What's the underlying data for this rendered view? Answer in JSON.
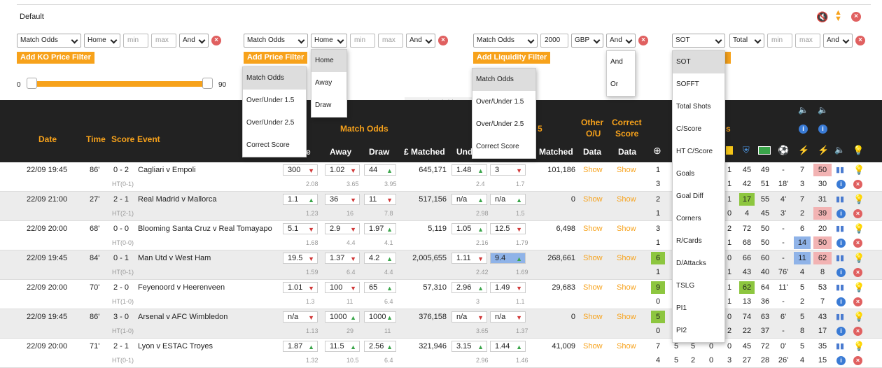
{
  "title": "Default",
  "filters": [
    {
      "market": "Match Odds",
      "selection": "Home",
      "min": "min",
      "max": "max",
      "op": "And"
    },
    {
      "market": "Match Odds",
      "selection": "Home",
      "min": "min",
      "max": "max",
      "op": "And"
    },
    {
      "market": "Match Odds",
      "amount": "2000",
      "currency": "GBP",
      "op": "And"
    },
    {
      "stat": "SOT",
      "scope": "Total",
      "min": "min",
      "max": "max",
      "op": "And"
    }
  ],
  "buttons": {
    "ko": "Add KO Price Filter",
    "price": "Add Price Filter",
    "liquidity": "Add Liquidity Filter"
  },
  "slider": {
    "min": "0",
    "max": "90"
  },
  "show_hide": "Show/Hide",
  "dropdowns": {
    "market": [
      "Match Odds",
      "Over/Under 1.5",
      "Over/Under 2.5",
      "Correct Score"
    ],
    "selection": [
      "Home",
      "Away",
      "Draw"
    ],
    "liquidity_market": [
      "Match Odds",
      "Over/Under 1.5",
      "Over/Under 2.5",
      "Correct Score"
    ],
    "op": [
      "And",
      "Or"
    ],
    "stat": [
      "SOT",
      "SOFFT",
      "Total Shots",
      "C/Score",
      "HT C/Score",
      "Goals",
      "Goal Diff",
      "Corners",
      "R/Cards",
      "D/Attacks",
      "TSLG",
      "PI1",
      "PI2"
    ]
  },
  "header": {
    "date": "Date",
    "time": "Time",
    "score": "Score",
    "event": "Event",
    "match_odds": "Match Odds",
    "home": "e",
    "away": "Away",
    "draw": "Draw",
    "matched": "£ Matched",
    "under": "Und",
    "over_partial": "5",
    "matched2": "Matched",
    "other1": "Other",
    "other2": "O/U",
    "correct1": "Correct",
    "correct2": "Score",
    "data": "Data",
    "stats_partial": "s"
  },
  "show_label": "Show",
  "rows": [
    {
      "date": "22/09 19:45",
      "time": "86'",
      "score": "0 - 2",
      "event": "Cagliari v Empoli",
      "ht": "HT(0-1)",
      "home": "300",
      "hd": "dn",
      "away": "1.02",
      "ad": "dn",
      "draw": "44",
      "dd": "up",
      "ho": "2.08",
      "ao": "3.65",
      "do": "3.95",
      "matched": "645,171",
      "u": "1.48",
      "ud": "up",
      "o": "3",
      "od": "dn",
      "uo": "2.4",
      "oo": "1.7",
      "m2": "101,186",
      "s1": "1",
      "s2": "3",
      "a1": "1",
      "a2": "1",
      "b1": "45",
      "b2": "42",
      "c1": "49",
      "c2": "51",
      "d1": "-",
      "d2": "18'",
      "e1": "7",
      "e2": "3",
      "f1": "50",
      "f2": "30",
      "f1c": "#f2b3b3",
      "ac": "",
      "gc": ""
    },
    {
      "date": "22/09 21:00",
      "time": "27'",
      "score": "2 - 1",
      "event": "Real Madrid v Mallorca",
      "ht": "HT(2-1)",
      "home": "1.1",
      "hd": "up",
      "away": "36",
      "ad": "dn",
      "draw": "11",
      "dd": "dn",
      "ho": "1.23",
      "ao": "16",
      "do": "7.8",
      "matched": "517,156",
      "u": "n/a",
      "ud": "up",
      "o": "n/a",
      "od": "up",
      "uo": "2.98",
      "oo": "1.5",
      "m2": "0",
      "s1": "2",
      "s2": "1",
      "a1": "1",
      "a2": "0",
      "b1": "17",
      "b2": "4",
      "c1": "55",
      "c2": "45",
      "d1": "4'",
      "d2": "3'",
      "e1": "7",
      "e2": "2",
      "f1": "31",
      "f2": "39",
      "f1c": "",
      "ac": "#8dc63f",
      "gc": "#f2b3b3"
    },
    {
      "date": "22/09 20:00",
      "time": "68'",
      "score": "0 - 0",
      "event": "Blooming Santa Cruz v Real Tomayapo",
      "ht": "HT(0-0)",
      "home": "5.1",
      "hd": "dn",
      "away": "2.9",
      "ad": "dn",
      "draw": "1.97",
      "dd": "up",
      "ho": "1.68",
      "ao": "4.4",
      "do": "4.1",
      "matched": "5,119",
      "u": "1.05",
      "ud": "up",
      "o": "12.5",
      "od": "dn",
      "uo": "2.16",
      "oo": "1.79",
      "m2": "6,498",
      "s1": "3",
      "s2": "1",
      "a1": "2",
      "a2": "1",
      "b1": "72",
      "b2": "68",
      "c1": "50",
      "c2": "50",
      "d1": "-",
      "d2": "-",
      "e1": "6",
      "e2": "14",
      "f1": "20",
      "f2": "50",
      "f1c": "",
      "ac": "",
      "gc": "#f2b3b3"
    },
    {
      "date": "22/09 19:45",
      "time": "84'",
      "score": "0 - 1",
      "event": "Man Utd v West Ham",
      "ht": "HT(0-1)",
      "home": "19.5",
      "hd": "dn",
      "away": "1.37",
      "ad": "dn",
      "draw": "4.2",
      "dd": "up",
      "ho": "1.59",
      "ao": "6.4",
      "do": "4.4",
      "matched": "2,005,655",
      "u": "1.11",
      "ud": "dn",
      "o": "9.4",
      "od": "up",
      "uo": "2.42",
      "oo": "1.69",
      "m2": "268,661",
      "s1": "6",
      "s2": "1",
      "a1": "0",
      "a2": "1",
      "b1": "66",
      "b2": "43",
      "c1": "60",
      "c2": "40",
      "d1": "-",
      "d2": "76'",
      "e1": "11",
      "e2": "4",
      "f1": "62",
      "f2": "8",
      "f1c": "#f2b3b3",
      "ac": "",
      "gc": ""
    },
    {
      "date": "22/09 20:00",
      "time": "70'",
      "score": "2 - 0",
      "event": "Feyenoord v Heerenveen",
      "ht": "HT(1-0)",
      "home": "1.01",
      "hd": "dn",
      "away": "100",
      "ad": "dn",
      "draw": "65",
      "dd": "up",
      "ho": "1.3",
      "ao": "11",
      "do": "6.4",
      "matched": "57,310",
      "u": "2.96",
      "ud": "up",
      "o": "1.49",
      "od": "dn",
      "uo": "3",
      "oo": "1.1",
      "m2": "29,683",
      "s1": "9",
      "s2": "0",
      "a1": "1",
      "a2": "1",
      "b1": "62",
      "b2": "13",
      "c1": "64",
      "c2": "36",
      "d1": "11'",
      "d2": "-",
      "e1": "5",
      "e2": "2",
      "f1": "53",
      "f2": "7",
      "f1c": "",
      "ac": "#8dc63f",
      "gc": ""
    },
    {
      "date": "22/09 19:45",
      "time": "86'",
      "score": "3 - 0",
      "event": "Arsenal v AFC Wimbledon",
      "ht": "HT(1-0)",
      "home": "n/a",
      "hd": "dn",
      "away": "1000",
      "ad": "up",
      "draw": "1000",
      "dd": "up",
      "ho": "1.13",
      "ao": "29",
      "do": "11",
      "matched": "376,158",
      "u": "n/a",
      "ud": "dn",
      "o": "n/a",
      "od": "dn",
      "uo": "3.65",
      "oo": "1.37",
      "m2": "0",
      "s1": "5",
      "s2": "0",
      "a1": "0",
      "a2": "2",
      "b1": "74",
      "b2": "22",
      "c1": "63",
      "c2": "37",
      "d1": "6'",
      "d2": "-",
      "e1": "5",
      "e2": "8",
      "f1": "43",
      "f2": "17",
      "f1c": "",
      "ac": "",
      "gc": ""
    },
    {
      "date": "22/09 20:00",
      "time": "71'",
      "score": "2 - 1",
      "event": "Lyon v ESTAC Troyes",
      "ht": "HT(0-1)",
      "home": "1.87",
      "hd": "up",
      "away": "11.5",
      "ad": "up",
      "draw": "2.56",
      "dd": "up",
      "ho": "1.32",
      "ao": "10.5",
      "do": "6.4",
      "matched": "321,946",
      "u": "3.15",
      "ud": "up",
      "o": "1.44",
      "od": "up",
      "uo": "2.96",
      "oo": "1.46",
      "m2": "41,009",
      "s1": "7",
      "s2": "4",
      "a1": "0",
      "a2": "3",
      "b1": "45",
      "b2": "27",
      "c1": "72",
      "c2": "28",
      "d1": "0'",
      "d2": "26'",
      "e1": "5",
      "e2": "4",
      "f1": "35",
      "f2": "15",
      "f1c": "",
      "ac": "",
      "gc": ""
    }
  ],
  "row_extra": {
    "r1": [
      "5",
      "5",
      "0"
    ],
    "r2": [
      "5",
      "2",
      "0"
    ]
  }
}
